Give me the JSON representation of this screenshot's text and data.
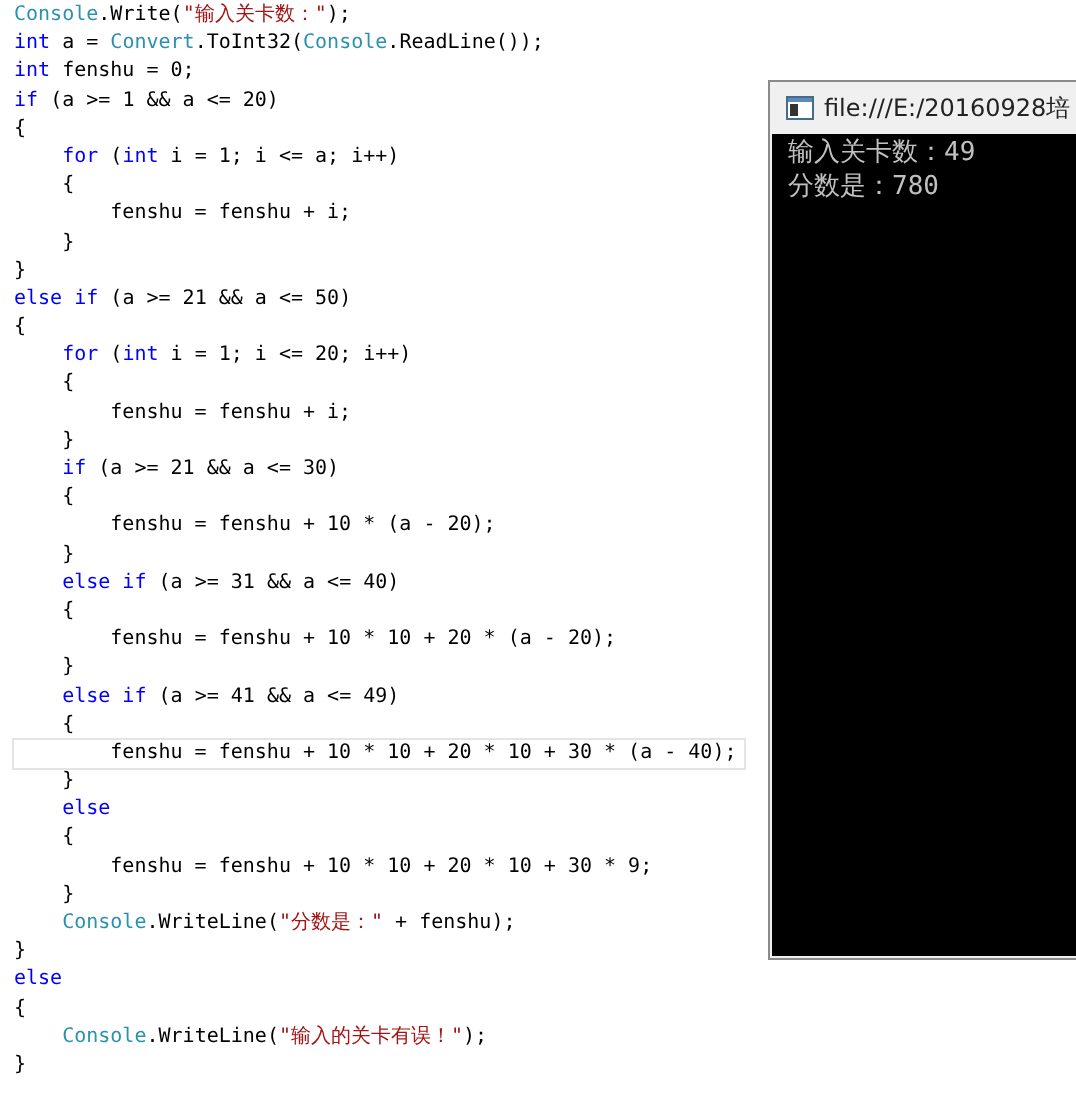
{
  "editor": {
    "lines": [
      {
        "current": false,
        "tokens": [
          {
            "kind": "type",
            "text": "Console"
          },
          {
            "kind": "plain",
            "text": ".Write("
          },
          {
            "kind": "string",
            "text": "\"输入关卡数：\""
          },
          {
            "kind": "plain",
            "text": ");"
          }
        ]
      },
      {
        "current": false,
        "tokens": [
          {
            "kind": "keyword",
            "text": "int"
          },
          {
            "kind": "plain",
            "text": " a = "
          },
          {
            "kind": "type",
            "text": "Convert"
          },
          {
            "kind": "plain",
            "text": ".ToInt32("
          },
          {
            "kind": "type",
            "text": "Console"
          },
          {
            "kind": "plain",
            "text": ".ReadLine());"
          }
        ]
      },
      {
        "current": false,
        "tokens": [
          {
            "kind": "keyword",
            "text": "int"
          },
          {
            "kind": "plain",
            "text": " fenshu = 0;"
          }
        ]
      },
      {
        "current": false,
        "tokens": [
          {
            "kind": "keyword",
            "text": "if"
          },
          {
            "kind": "plain",
            "text": " (a >= 1 && a <= 20)"
          }
        ]
      },
      {
        "current": false,
        "tokens": [
          {
            "kind": "plain",
            "text": "{"
          }
        ]
      },
      {
        "current": false,
        "tokens": [
          {
            "kind": "keyword",
            "text": "    for"
          },
          {
            "kind": "plain",
            "text": " ("
          },
          {
            "kind": "keyword",
            "text": "int"
          },
          {
            "kind": "plain",
            "text": " i = 1; i <= a; i++)"
          }
        ]
      },
      {
        "current": false,
        "tokens": [
          {
            "kind": "plain",
            "text": "    {"
          }
        ]
      },
      {
        "current": false,
        "tokens": [
          {
            "kind": "plain",
            "text": "        fenshu = fenshu + i;"
          }
        ]
      },
      {
        "current": false,
        "tokens": [
          {
            "kind": "plain",
            "text": "    }"
          }
        ]
      },
      {
        "current": false,
        "tokens": [
          {
            "kind": "plain",
            "text": "}"
          }
        ]
      },
      {
        "current": false,
        "tokens": [
          {
            "kind": "keyword",
            "text": "else if"
          },
          {
            "kind": "plain",
            "text": " (a >= 21 && a <= 50)"
          }
        ]
      },
      {
        "current": false,
        "tokens": [
          {
            "kind": "plain",
            "text": "{"
          }
        ]
      },
      {
        "current": false,
        "tokens": [
          {
            "kind": "keyword",
            "text": "    for"
          },
          {
            "kind": "plain",
            "text": " ("
          },
          {
            "kind": "keyword",
            "text": "int"
          },
          {
            "kind": "plain",
            "text": " i = 1; i <= 20; i++)"
          }
        ]
      },
      {
        "current": false,
        "tokens": [
          {
            "kind": "plain",
            "text": "    {"
          }
        ]
      },
      {
        "current": false,
        "tokens": [
          {
            "kind": "plain",
            "text": "        fenshu = fenshu + i;"
          }
        ]
      },
      {
        "current": false,
        "tokens": [
          {
            "kind": "plain",
            "text": "    }"
          }
        ]
      },
      {
        "current": false,
        "tokens": [
          {
            "kind": "keyword",
            "text": "    if"
          },
          {
            "kind": "plain",
            "text": " (a >= 21 && a <= 30)"
          }
        ]
      },
      {
        "current": false,
        "tokens": [
          {
            "kind": "plain",
            "text": "    {"
          }
        ]
      },
      {
        "current": false,
        "tokens": [
          {
            "kind": "plain",
            "text": "        fenshu = fenshu + 10 * (a - 20);"
          }
        ]
      },
      {
        "current": false,
        "tokens": [
          {
            "kind": "plain",
            "text": "    }"
          }
        ]
      },
      {
        "current": false,
        "tokens": [
          {
            "kind": "keyword",
            "text": "    else if"
          },
          {
            "kind": "plain",
            "text": " (a >= 31 && a <= 40)"
          }
        ]
      },
      {
        "current": false,
        "tokens": [
          {
            "kind": "plain",
            "text": "    {"
          }
        ]
      },
      {
        "current": false,
        "tokens": [
          {
            "kind": "plain",
            "text": "        fenshu = fenshu + 10 * 10 + 20 * (a - 20);"
          }
        ]
      },
      {
        "current": false,
        "tokens": [
          {
            "kind": "plain",
            "text": "    }"
          }
        ]
      },
      {
        "current": false,
        "tokens": [
          {
            "kind": "keyword",
            "text": "    else if"
          },
          {
            "kind": "plain",
            "text": " (a >= 41 && a <= 49)"
          }
        ]
      },
      {
        "current": false,
        "tokens": [
          {
            "kind": "plain",
            "text": "    {"
          }
        ]
      },
      {
        "current": true,
        "tokens": [
          {
            "kind": "plain",
            "text": "        fenshu = fenshu + 10 * 10 + 20 * 10 + 30 * (a - 40);"
          }
        ]
      },
      {
        "current": false,
        "tokens": [
          {
            "kind": "plain",
            "text": "    }"
          }
        ]
      },
      {
        "current": false,
        "tokens": [
          {
            "kind": "keyword",
            "text": "    else"
          }
        ]
      },
      {
        "current": false,
        "tokens": [
          {
            "kind": "plain",
            "text": "    {"
          }
        ]
      },
      {
        "current": false,
        "tokens": [
          {
            "kind": "plain",
            "text": "        fenshu = fenshu + 10 * 10 + 20 * 10 + 30 * 9;"
          }
        ]
      },
      {
        "current": false,
        "tokens": [
          {
            "kind": "plain",
            "text": "    }"
          }
        ]
      },
      {
        "current": false,
        "tokens": [
          {
            "kind": "type",
            "text": "    Console"
          },
          {
            "kind": "plain",
            "text": ".WriteLine("
          },
          {
            "kind": "string",
            "text": "\"分数是：\""
          },
          {
            "kind": "plain",
            "text": " + fenshu);"
          }
        ]
      },
      {
        "current": false,
        "tokens": [
          {
            "kind": "plain",
            "text": "}"
          }
        ]
      },
      {
        "current": false,
        "tokens": [
          {
            "kind": "keyword",
            "text": "else"
          }
        ]
      },
      {
        "current": false,
        "tokens": [
          {
            "kind": "plain",
            "text": "{"
          }
        ]
      },
      {
        "current": false,
        "tokens": [
          {
            "kind": "type",
            "text": "    Console"
          },
          {
            "kind": "plain",
            "text": ".WriteLine("
          },
          {
            "kind": "string",
            "text": "\"输入的关卡有误！\""
          },
          {
            "kind": "plain",
            "text": ");"
          }
        ]
      },
      {
        "current": false,
        "tokens": [
          {
            "kind": "plain",
            "text": "}"
          }
        ]
      }
    ]
  },
  "console": {
    "title": "file:///E:/20160928培",
    "lines": [
      "输入关卡数：49",
      "分数是：780"
    ]
  }
}
